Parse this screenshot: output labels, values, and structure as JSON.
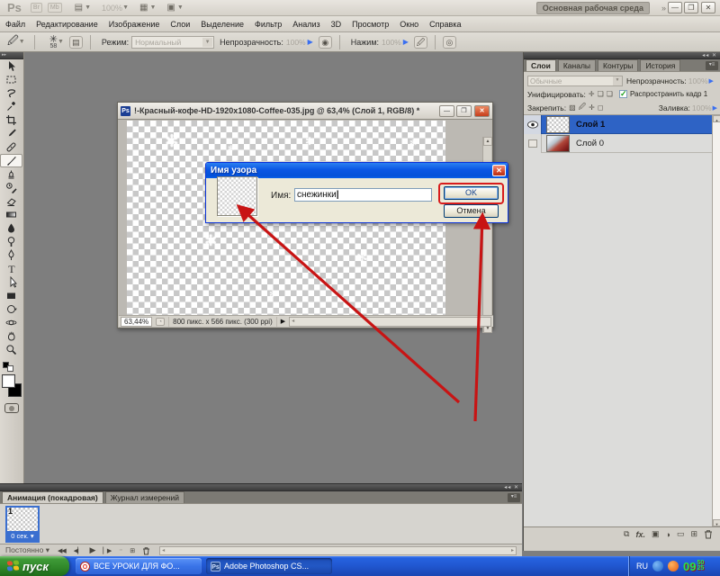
{
  "app": {
    "logo": "Ps",
    "topbar_zoom": "100%",
    "workspace_button": "Основная рабочая среда",
    "chevron": "»",
    "menus": [
      "Файл",
      "Редактирование",
      "Изображение",
      "Слои",
      "Выделение",
      "Фильтр",
      "Анализ",
      "3D",
      "Просмотр",
      "Окно",
      "Справка"
    ]
  },
  "options": {
    "brush_size": "58",
    "mode_label": "Режим:",
    "mode_value": "Нормальный",
    "opacity_label": "Непрозрачность:",
    "opacity_value": "100%",
    "flow_label": "Нажим:",
    "flow_value": "100%"
  },
  "document": {
    "title": "!-Красный-кофе-HD-1920x1080-Coffee-035.jpg @ 63,4% (Слой 1, RGB/8) *",
    "status_zoom": "63,44%",
    "status_info": "800 пикс. x 566 пикс. (300 ppi)"
  },
  "dialog": {
    "title": "Имя узора",
    "name_label": "Имя:",
    "name_value": "снежинки",
    "ok_label": "OK",
    "cancel_label": "Отмена"
  },
  "layers": {
    "tabs": [
      "Слои",
      "Каналы",
      "Контуры",
      "История"
    ],
    "blend_mode": "Обычные",
    "opacity_label": "Непрозрачность:",
    "opacity_value": "100%",
    "unify_label": "Унифицировать:",
    "propagate_label": "Распространить кадр 1",
    "lock_label": "Закрепить:",
    "fill_label": "Заливка:",
    "fill_value": "100%",
    "items": [
      {
        "name": "Слой 1"
      },
      {
        "name": "Слой 0"
      }
    ]
  },
  "animation": {
    "tabs": [
      "Анимация (покадровая)",
      "Журнал измерений"
    ],
    "frame_number": "1",
    "frame_delay": "0 сек.",
    "loop_mode": "Постоянно"
  },
  "taskbar": {
    "start_label": "пуск",
    "tasks": [
      {
        "label": "ВСЕ УРОКИ ДЛЯ ФО..."
      },
      {
        "label": "Adobe Photoshop CS..."
      }
    ],
    "tray_lang": "RU",
    "clock_hour": "09",
    "clock_min": "50",
    "clock_sec": "25"
  },
  "colors": {
    "selection_blue": "#2e63c5",
    "xp_taskbar_blue": "#2663e0",
    "annotation_red": "#d81c1c",
    "clock_green": "#27e34c"
  }
}
